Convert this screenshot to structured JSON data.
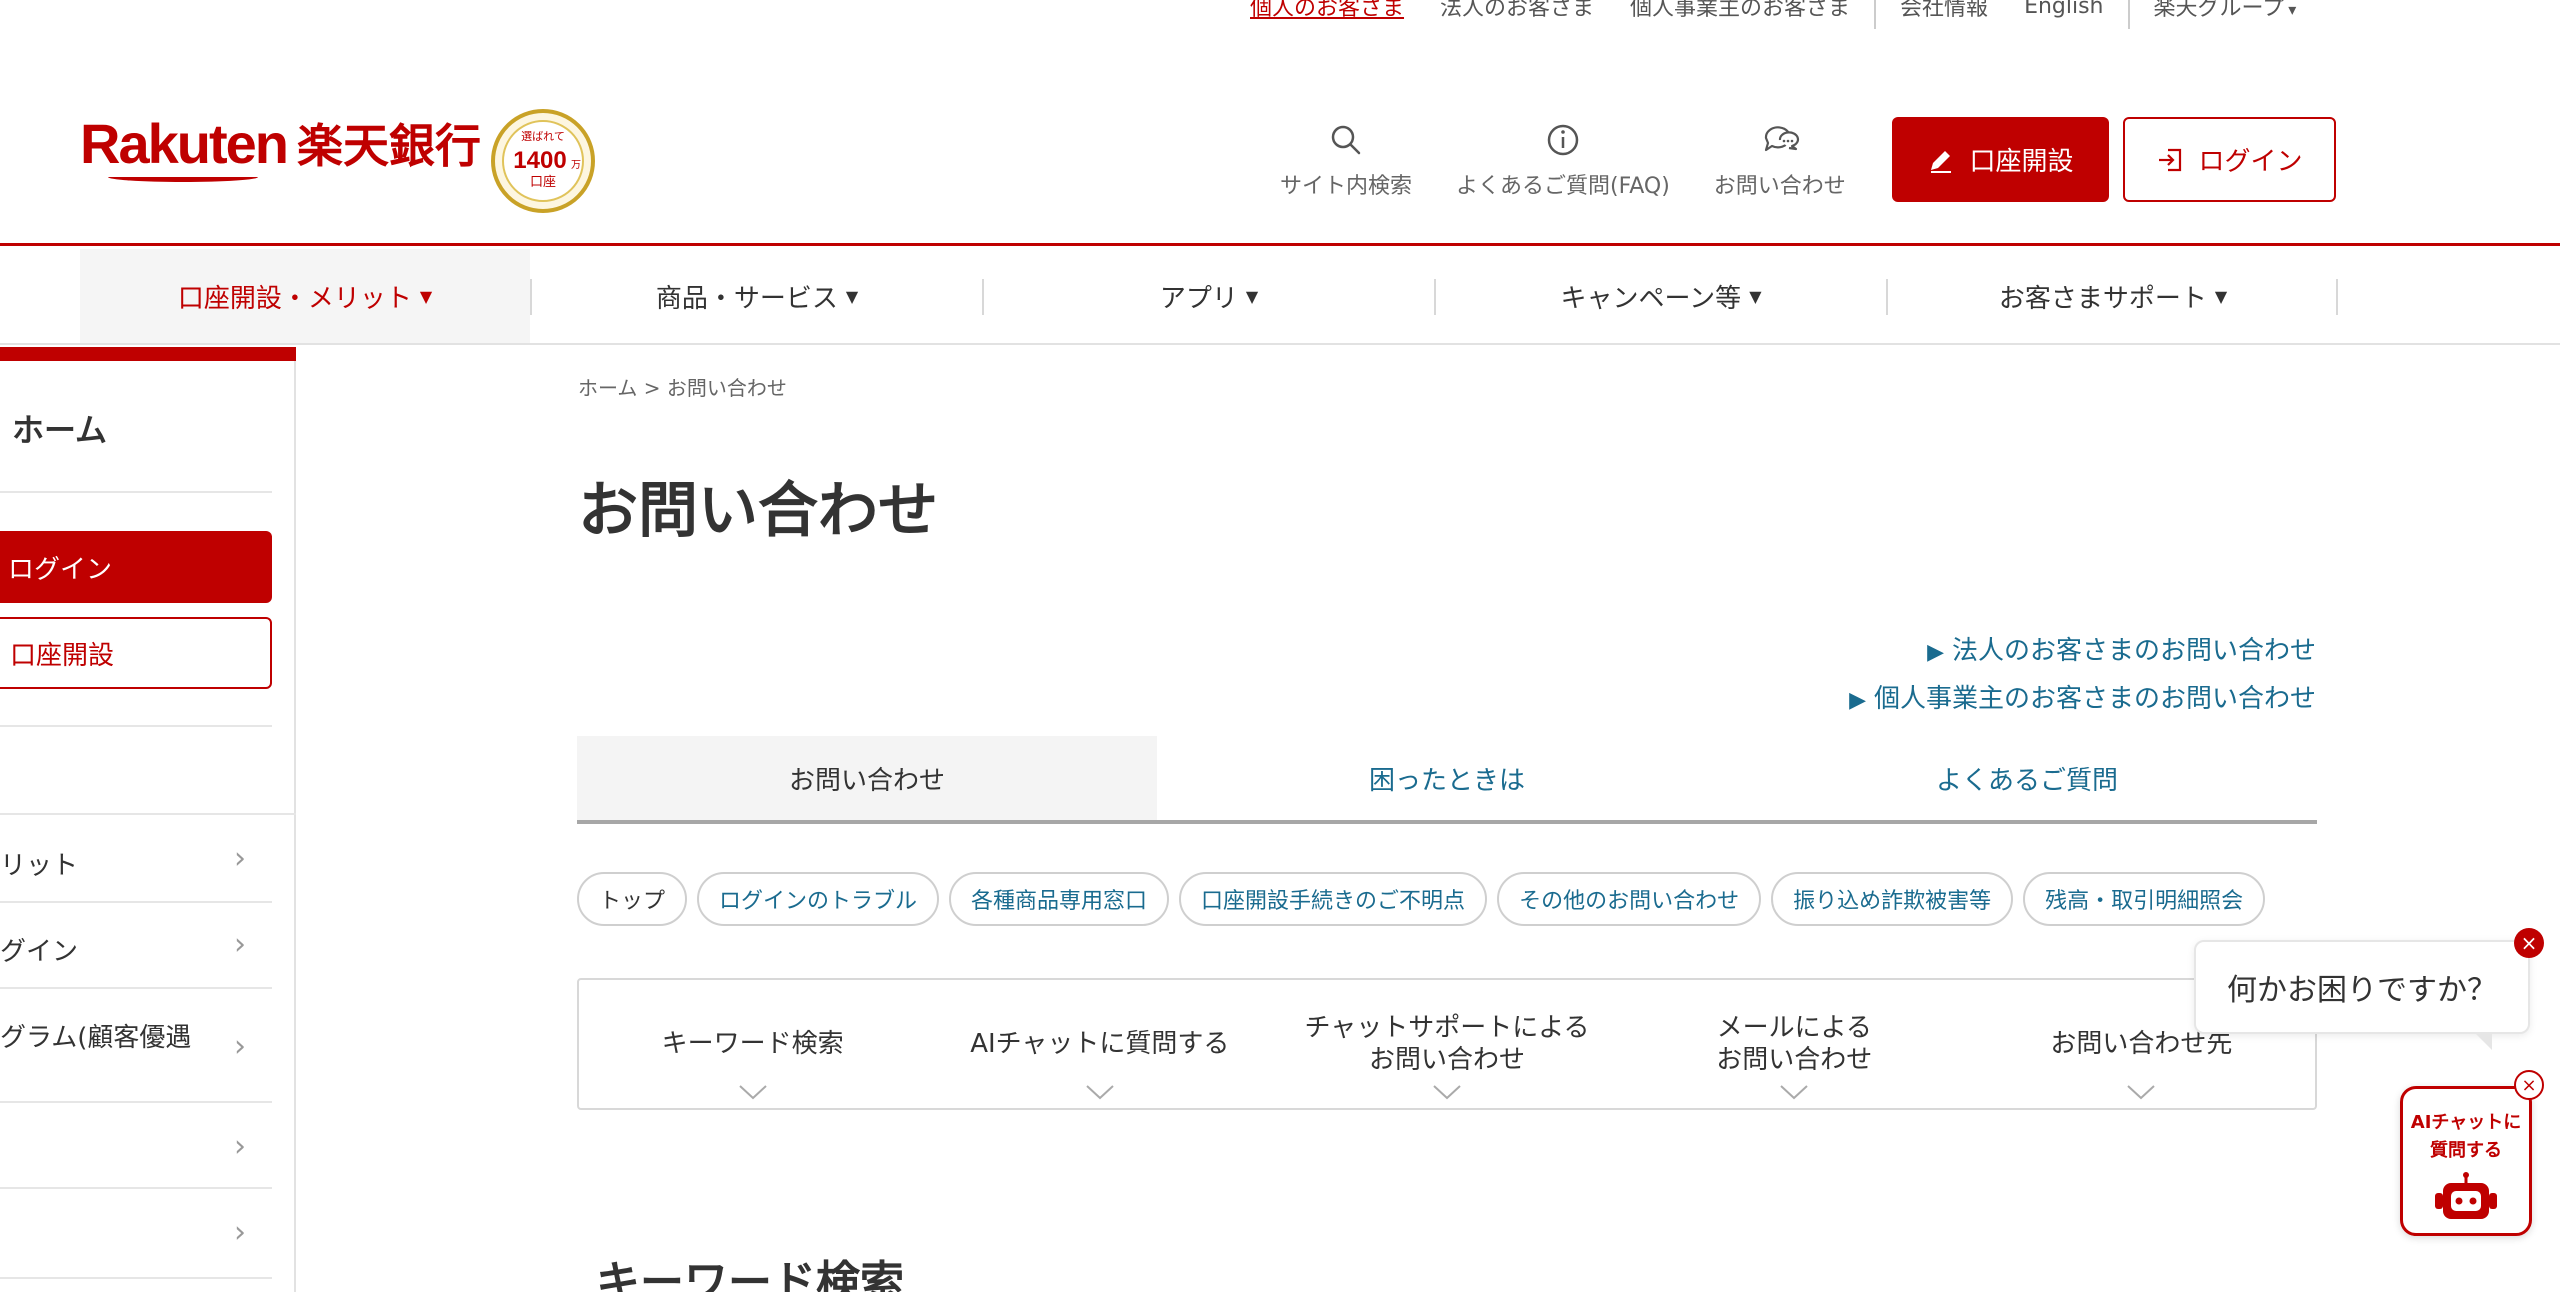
{
  "brand": {
    "wordmark": "Rakuten",
    "bank_name": "楽天銀行",
    "badge_top": "選ばれて",
    "badge_number": "1400",
    "badge_unit": "万",
    "badge_bottom": "口座",
    "brand_color": "#bf0000"
  },
  "utility_nav": {
    "items": [
      "個人のお客さま",
      "法人のお客さま",
      "個人事業主のお客さま",
      "会社情報",
      "English",
      "楽天グループ"
    ],
    "group_caret": "▾"
  },
  "header": {
    "search_label": "サイト内検索",
    "faq_label": "よくあるご質問(FAQ)",
    "contact_label": "お問い合わせ",
    "open_account_label": "口座開設",
    "login_label": "ログイン"
  },
  "global_nav": {
    "items": [
      "口座開設・メリット",
      "商品・サービス",
      "アプリ",
      "キャンペーン等",
      "お客さまサポート"
    ],
    "caret": "▼"
  },
  "sidebar": {
    "home_label": "ホーム",
    "login_label": "ログイン",
    "open_account_label": "口座開設",
    "items": [
      "リット",
      "グイン",
      "グラム(顧客優遇",
      "",
      ""
    ],
    "chevron": "›"
  },
  "main": {
    "breadcrumb_home": "ホーム",
    "breadcrumb_sep": ">",
    "breadcrumb_current": "お問い合わせ",
    "title": "お問い合わせ",
    "corp_links": [
      "法人のお客さまのお問い合わせ",
      "個人事業主のお客さまのお問い合わせ"
    ],
    "corp_arrow": "▶",
    "tabs": [
      "お問い合わせ",
      "困ったときは",
      "よくあるご質問"
    ],
    "chips": [
      "トップ",
      "ログインのトラブル",
      "各種商品専用窓口",
      "口座開設手続きのご不明点",
      "その他のお問い合わせ",
      "振り込め詐欺被害等",
      "残高・取引明細照会"
    ],
    "methods": [
      [
        "キーワード検索"
      ],
      [
        "AIチャットに質問する"
      ],
      [
        "チャットサポートによる",
        "お問い合わせ"
      ],
      [
        "メールによる",
        "お問い合わせ"
      ],
      [
        "お問い合わせ先"
      ]
    ],
    "section_title": "キーワード検索"
  },
  "help": {
    "bubble_text": "何かお困りですか？",
    "close_glyph": "×",
    "ai_widget_line1": "AIチャットに",
    "ai_widget_line2": "質問する"
  }
}
